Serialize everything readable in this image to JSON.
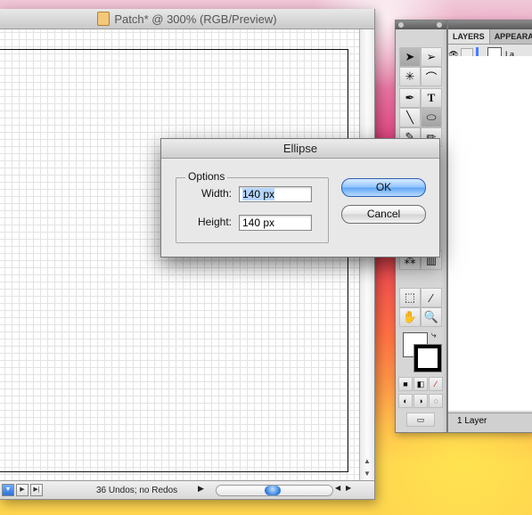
{
  "document": {
    "title": "Patch* @ 300% (RGB/Preview)",
    "status_text": "36 Undos; no Redos"
  },
  "layers_panel": {
    "tabs": [
      "LAYERS",
      "APPEARA"
    ],
    "layer_name": "La",
    "footer": "1 Layer"
  },
  "tools": [
    "selection",
    "direct-selection",
    "magic-wand",
    "lasso",
    "pen",
    "type",
    "line",
    "ellipse",
    "paintbrush",
    "pencil"
  ],
  "dialog": {
    "title": "Ellipse",
    "group_label": "Options",
    "width_label": "Width:",
    "width_value": "140 px",
    "height_label": "Height:",
    "height_value": "140 px",
    "ok_label": "OK",
    "cancel_label": "Cancel"
  }
}
